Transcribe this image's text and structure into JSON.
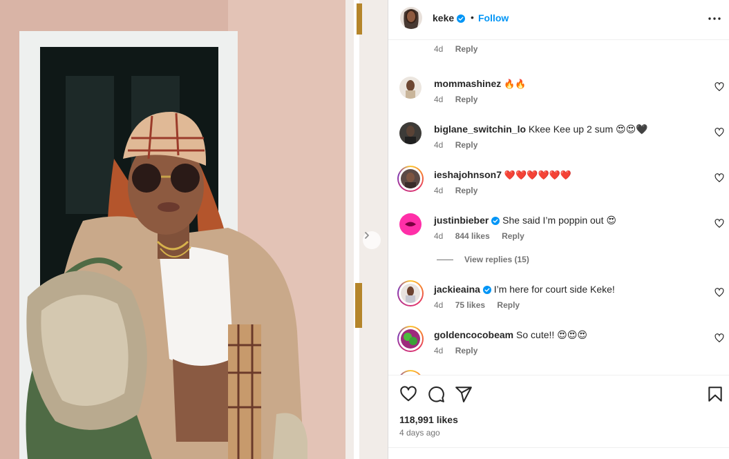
{
  "post": {
    "photo_alt": "Photo by keke",
    "next_icon": "chevron-right-icon"
  },
  "header": {
    "username": "keke",
    "verified": true,
    "separator": "•",
    "follow_label": "Follow",
    "more_icon": "more-options-icon"
  },
  "comments": [
    {
      "username": "",
      "text": "😍😍",
      "age": "4d",
      "likes": "",
      "reply_label": "Reply",
      "verified": false
    },
    {
      "username": "mommashinez",
      "text": "🔥🔥",
      "age": "4d",
      "likes": "",
      "reply_label": "Reply",
      "verified": false
    },
    {
      "username": "biglane_switchin_lo",
      "text": "Kkee Kee up 2 sum 😍😍🖤",
      "age": "4d",
      "likes": "",
      "reply_label": "Reply",
      "verified": false
    },
    {
      "username": "ieshajohnson7",
      "text": "❤️❤️❤️❤️❤️❤️",
      "age": "4d",
      "likes": "",
      "reply_label": "Reply",
      "verified": false
    },
    {
      "username": "justinbieber",
      "text": "She said I’m poppin out 😍",
      "age": "4d",
      "likes": "844 likes",
      "reply_label": "Reply",
      "verified": true
    },
    {
      "username": "jackieaina",
      "text": "I’m here for court side Keke!",
      "age": "4d",
      "likes": "75 likes",
      "reply_label": "Reply",
      "verified": true
    },
    {
      "username": "goldencocobeam",
      "text": "So cute!! 😍😍😍",
      "age": "4d",
      "likes": "",
      "reply_label": "Reply",
      "verified": false
    }
  ],
  "view_replies": "View replies (15)",
  "actions": {
    "like_icon": "heart-icon",
    "comment_icon": "comment-icon",
    "share_icon": "share-icon",
    "save_icon": "bookmark-icon"
  },
  "stats": {
    "likes": "118,991 likes",
    "time_ago": "4 days ago"
  },
  "colors": {
    "accent": "#0095f6",
    "text": "#262626",
    "secondary": "#737373",
    "border": "#dbdbdb"
  }
}
